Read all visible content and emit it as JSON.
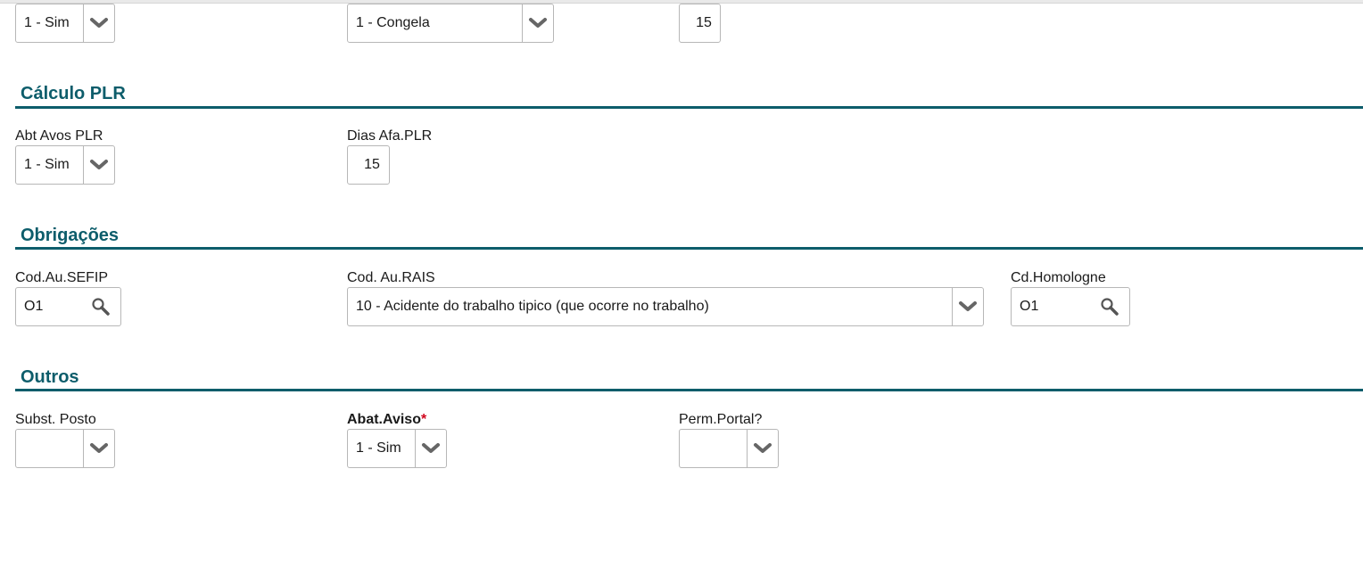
{
  "top_row": {
    "field_a_value": "1 - Sim",
    "field_b_value": "1 - Congela",
    "field_c_value": "15"
  },
  "calculo_plr": {
    "title": "Cálculo PLR",
    "abt_avos_plr": {
      "label": "Abt Avos PLR",
      "value": "1 - Sim"
    },
    "dias_afa_plr": {
      "label": "Dias Afa.PLR",
      "value": "15"
    }
  },
  "obrigacoes": {
    "title": "Obrigações",
    "cod_au_sefip": {
      "label": "Cod.Au.SEFIP",
      "value": "O1"
    },
    "cod_au_rais": {
      "label": "Cod. Au.RAIS",
      "value": "10 - Acidente do trabalho tipico (que ocorre no trabalho)"
    },
    "cd_homologne": {
      "label": "Cd.Homologne",
      "value": "O1"
    }
  },
  "outros": {
    "title": "Outros",
    "subst_posto": {
      "label": "Subst. Posto",
      "value": ""
    },
    "abat_aviso": {
      "label": "Abat.Aviso",
      "required_mark": "*",
      "value": "1 - Sim"
    },
    "perm_portal": {
      "label": "Perm.Portal?",
      "value": ""
    }
  },
  "icons": {
    "dropdown": "chevron-down-icon",
    "lookup": "search-icon"
  },
  "colors": {
    "section_title": "#0d5d6b",
    "section_rule": "#0d5d6b",
    "required": "#d0021b",
    "border": "#b7b7b7"
  }
}
